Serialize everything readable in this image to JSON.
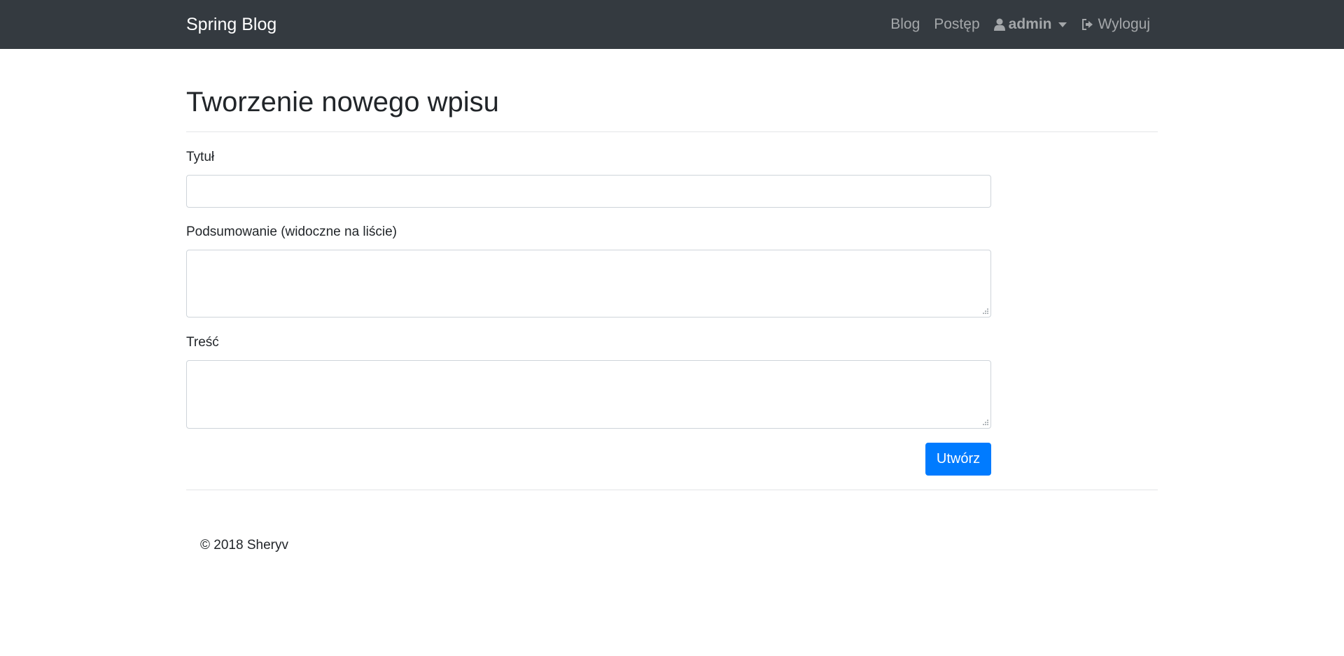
{
  "navbar": {
    "brand": "Spring Blog",
    "links": {
      "blog": "Blog",
      "progress": "Postęp",
      "user": "admin",
      "logout": "Wyloguj"
    },
    "icons": {
      "user": "user-icon",
      "caret": "chevron-down-icon",
      "logout": "sign-out-icon"
    }
  },
  "page": {
    "title": "Tworzenie nowego wpisu"
  },
  "form": {
    "title_label": "Tytuł",
    "title_value": "",
    "summary_label": "Podsumowanie (widoczne na liście)",
    "summary_value": "",
    "content_label": "Treść",
    "content_value": "",
    "submit_label": "Utwórz"
  },
  "footer": {
    "text": "© 2018 Sheryv"
  },
  "colors": {
    "navbar_bg": "#343a40",
    "primary": "#007bff",
    "text": "#212529"
  }
}
